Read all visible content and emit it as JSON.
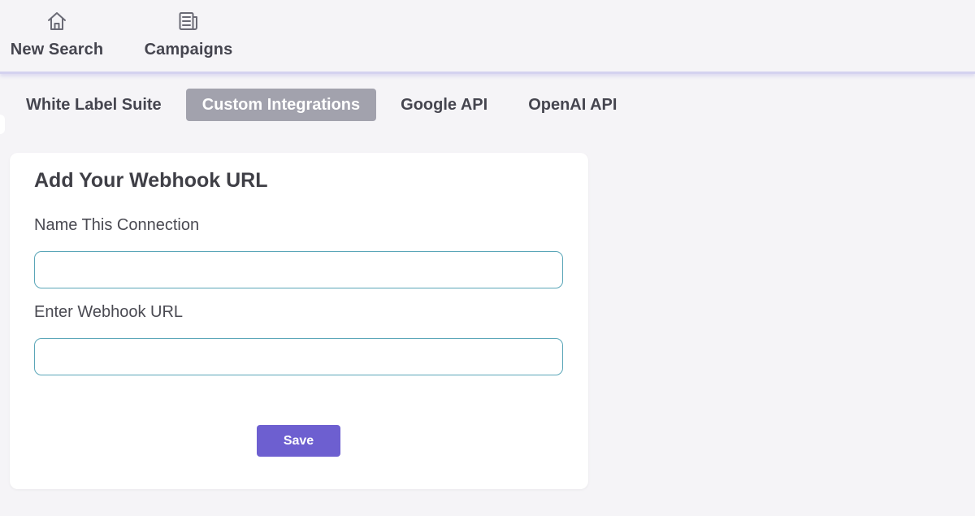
{
  "nav": {
    "items": [
      {
        "label": "New Search",
        "icon": "home-icon"
      },
      {
        "label": "Campaigns",
        "icon": "document-icon"
      }
    ]
  },
  "tabs": [
    {
      "label": "White Label Suite",
      "active": false
    },
    {
      "label": "Custom Integrations",
      "active": true
    },
    {
      "label": "Google API",
      "active": false
    },
    {
      "label": "OpenAI API",
      "active": false
    }
  ],
  "form": {
    "title": "Add Your Webhook URL",
    "name_label": "Name This Connection",
    "name_value": "",
    "url_label": "Enter Webhook URL",
    "url_value": "",
    "save_label": "Save"
  },
  "colors": {
    "accent": "#6d5fd0",
    "active_tab": "#a2a2ad",
    "input_border": "#5aa6b8",
    "background": "#f5f4f7"
  }
}
